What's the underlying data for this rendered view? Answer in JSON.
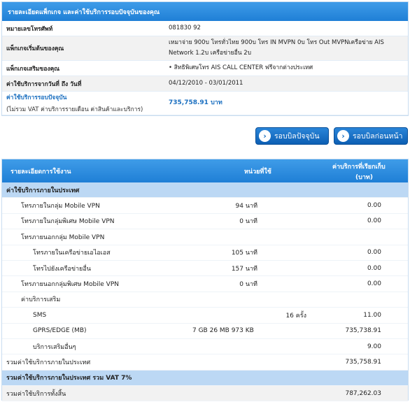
{
  "summary": {
    "header": "รายละเอียดแพ็กเกจ และค่าใช้บริการรอบปัจจุบันของคุณ",
    "rows": [
      {
        "label": "หมายเลขโทรศัพท์",
        "value": "081830   92"
      },
      {
        "label": "แพ็กเกจเริ่มต้นของคุณ",
        "value": " เหมาจ่าย 900บ โทรทั่วไทย 900บ โทร IN MVPN 0บ โทร Out MVPNเครือข่าย AIS Network 1.2บ เครือข่ายอื่น 2บ"
      },
      {
        "label": "แพ็กเกจเสริมของคุณ",
        "value": "•  สิทธิพิเศษโทร AIS CALL CENTER ฟรีจากต่างประเทศ"
      },
      {
        "label": "ค่าใช้บริการจากวันที่ ถึง วันที่",
        "value": "04/12/2010 - 03/01/2011"
      }
    ],
    "current": {
      "label": "ค่าใช้บริการรอบปัจจุบัน",
      "sublabel": "(ไม่รวม VAT ค่าบริการรายเดือน ค่าสินค้าและบริการ)",
      "value": "735,758.91 บาท"
    }
  },
  "buttons": {
    "current_cycle": "รอบบิลปัจจุบัน",
    "previous_cycle": "รอบบิลก่อนหน้า"
  },
  "usage": {
    "header": {
      "detail": "รายละเอียดการใช้งาน",
      "unit": "หน่วยที่ใช้",
      "charge": "ค่าบริการที่เรียกเก็บ",
      "charge_unit": "(บาท)"
    },
    "rows": [
      {
        "kind": "sec",
        "label": "ค่าใช้บริการภายในประเทศ",
        "indent": 0
      },
      {
        "kind": "item",
        "label": "โทรภายในกลุ่ม Mobile VPN",
        "indent": 1,
        "unit": "94 นาที",
        "amount": "0.00"
      },
      {
        "kind": "item",
        "label": "โทรภายในกลุ่มพิเศษ Mobile VPN",
        "indent": 1,
        "unit": "0 นาที",
        "amount": "0.00"
      },
      {
        "kind": "item",
        "label": "โทรภายนอกกลุ่ม Mobile VPN",
        "indent": 1
      },
      {
        "kind": "item",
        "label": "โทรภายในเครือข่ายเอไอเอส",
        "indent": 2,
        "unit": "105 นาที",
        "amount": "0.00"
      },
      {
        "kind": "item",
        "label": "โทรไปยังเครือข่ายอื่น",
        "indent": 2,
        "unit": "157 นาที",
        "amount": "0.00"
      },
      {
        "kind": "item",
        "label": "โทรภายนอกกลุ่มพิเศษ Mobile VPN",
        "indent": 1,
        "unit": "0 นาที",
        "amount": "0.00"
      },
      {
        "kind": "item",
        "label": "ค่าบริการเสริม",
        "indent": 1
      },
      {
        "kind": "item",
        "label": "SMS",
        "indent": 2,
        "unit2": "16 ครั้ง",
        "amount": "11.00"
      },
      {
        "kind": "item",
        "label": "GPRS/EDGE (MB)",
        "indent": 2,
        "unit3": "7 GB 26 MB 973 KB",
        "amount": "735,738.91"
      },
      {
        "kind": "item",
        "label": "บริการเสริมอื่นๆ",
        "indent": 2,
        "amount": "9.00"
      },
      {
        "kind": "item",
        "label": "รวมค่าใช้บริการภายในประเทศ",
        "indent": 0,
        "amount": "735,758.91"
      },
      {
        "kind": "sec",
        "label": "รวมค่าใช้บริการภายในประเทศ รวม VAT 7%",
        "indent": 0
      },
      {
        "kind": "tot",
        "label": "รวมค่าใช้บริการทั้งสิ้น",
        "indent": 0,
        "amount": "787,262.03"
      }
    ]
  }
}
